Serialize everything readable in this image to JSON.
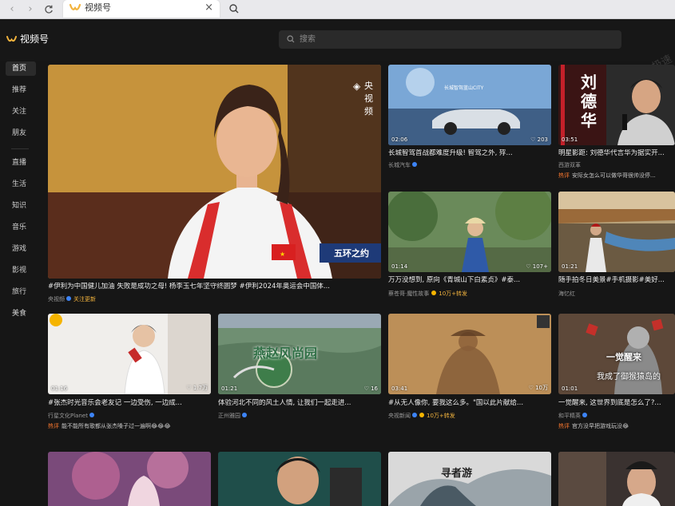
{
  "browser": {
    "tab_title": "视频号",
    "tab_close": "×"
  },
  "app": {
    "brand_name": "视频号",
    "search_placeholder": "搜索",
    "watermark": "极速",
    "accent_color": "#f2b33d"
  },
  "sidebar": {
    "items": [
      "首页",
      "推荐",
      "关注",
      "朋友",
      "直播",
      "生活",
      "知识",
      "音乐",
      "游戏",
      "影视",
      "旅行",
      "美食"
    ]
  },
  "feed": {
    "featured": {
      "title": "#伊利为中国健儿加油 失败是成功之母! 杨李玉七年坚守终圆梦 #伊利2024年奥运会中国体...",
      "author": "央视频",
      "follow_label": "关注更新",
      "channel_logo": "央视频",
      "lower_third": "五环之约"
    },
    "cards": [
      {
        "id": "c1",
        "title": "长城智驾首战都难度升级! 智驾之外, 殍...",
        "author": "长城汽车",
        "duration": "02:06",
        "likes": "203",
        "overlay": "长城智驾蓝山CITY"
      },
      {
        "id": "c2",
        "title": "明星影距: 刘德华代言华为据实开...",
        "author": "西游双革",
        "duration": "03:51",
        "likes": "",
        "hot_tag": "热评",
        "hot_text": "安际女怎么可以做华哥很帅没停...",
        "overlay": "刘德华"
      },
      {
        "id": "c3",
        "title": "万万没想到, 原向《青城山下白素贞》#泰...",
        "author": "蔡苍哥·魔性故事",
        "duration": "01:14",
        "likes": "107+",
        "spread": "10万+转发"
      },
      {
        "id": "c4",
        "title": "随手拍冬日美景#手机摄影#美好...",
        "author": "海忆红",
        "duration": "01:21",
        "likes": ""
      },
      {
        "id": "c5",
        "title": "#张杰时光音乐会老友记 一边受伤, 一边成...",
        "author": "行星文化Planet",
        "duration": "01:16",
        "likes": "1.7万",
        "hot_tag": "热评",
        "hot_text": "能不能所有歌都从张杰嗓子过一遍啊😂😂😂"
      },
      {
        "id": "c6",
        "title": "体验河北不同的风土人情, 让我们一起走进...",
        "author": "正州雅园",
        "duration": "01:21",
        "likes": "16",
        "overlay": "燕赵风尚园"
      },
      {
        "id": "c7",
        "title": "#从无人像你, 要我这么多。\"国以此片献给...",
        "author": "央视新闻",
        "duration": "03:41",
        "likes": "10万",
        "spread": "10万+转发"
      },
      {
        "id": "c8",
        "title": "一觉醒来, 这世界到底是怎么了?...",
        "author": "和平精英",
        "duration": "01:01",
        "likes": "",
        "hot_tag": "热评",
        "hot_text": "官方没早把游戏玩没😂",
        "overlay": "一觉醒来",
        "overlay2": "我成了御猴猿岛的"
      }
    ],
    "bottom_overlay": "寻者游"
  }
}
